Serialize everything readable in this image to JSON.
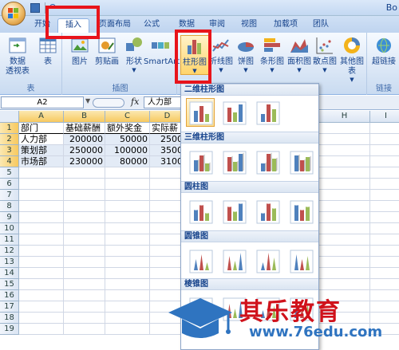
{
  "title_bar": {
    "doc_title": "Bo"
  },
  "tabs": [
    {
      "label": "开始",
      "active": false
    },
    {
      "label": "插入",
      "active": true
    },
    {
      "label": "页面布局",
      "active": false
    },
    {
      "label": "公式",
      "active": false
    },
    {
      "label": "数据",
      "active": false
    },
    {
      "label": "审阅",
      "active": false
    },
    {
      "label": "视图",
      "active": false
    },
    {
      "label": "加载项",
      "active": false
    },
    {
      "label": "团队",
      "active": false
    }
  ],
  "ribbon": {
    "groups": {
      "table": {
        "label": "表",
        "buttons": [
          {
            "label": "数据\n透视表"
          },
          {
            "label": "表"
          }
        ]
      },
      "illustrations": {
        "label": "插图",
        "buttons": [
          {
            "label": "图片"
          },
          {
            "label": "剪贴画"
          },
          {
            "label": "形状"
          },
          {
            "label": "SmartArt"
          }
        ]
      },
      "charts": {
        "buttons": [
          {
            "label": "柱形图"
          },
          {
            "label": "折线图"
          },
          {
            "label": "饼图"
          },
          {
            "label": "条形图"
          },
          {
            "label": "面积图"
          },
          {
            "label": "散点图"
          },
          {
            "label": "其他图表"
          }
        ]
      },
      "links": {
        "label": "链接",
        "buttons": [
          {
            "label": "超链接"
          }
        ]
      }
    }
  },
  "formula_bar": {
    "name_box": "A2",
    "fx": "fx",
    "content": "人力部"
  },
  "sheet": {
    "columns": [
      "A",
      "B",
      "C",
      "D",
      "H",
      "I"
    ],
    "rows": [
      "1",
      "2",
      "3",
      "4",
      "5",
      "6",
      "7",
      "8",
      "9",
      "10",
      "11",
      "12",
      "13",
      "14",
      "15",
      "16",
      "17",
      "18",
      "19"
    ],
    "cells": [
      [
        "部门",
        "基础薪酬",
        "额外奖金",
        "实际薪"
      ],
      [
        "人力部",
        "200000",
        "50000",
        "2500"
      ],
      [
        "策划部",
        "250000",
        "100000",
        "3500"
      ],
      [
        "市场部",
        "230000",
        "80000",
        "3100"
      ]
    ]
  },
  "gallery": {
    "sections": [
      {
        "title": "二维柱形图"
      },
      {
        "title": "三维柱形图"
      },
      {
        "title": "圆柱图"
      },
      {
        "title": "圆锥图"
      },
      {
        "title": "棱锥图"
      }
    ]
  },
  "watermark": {
    "title": "其乐教育",
    "url": "www.76edu.com"
  },
  "colors": {
    "highlight": "#e8141b",
    "ribbon_text": "#15428b",
    "watermark_red": "#d0121b",
    "watermark_blue": "#2f74c0"
  }
}
